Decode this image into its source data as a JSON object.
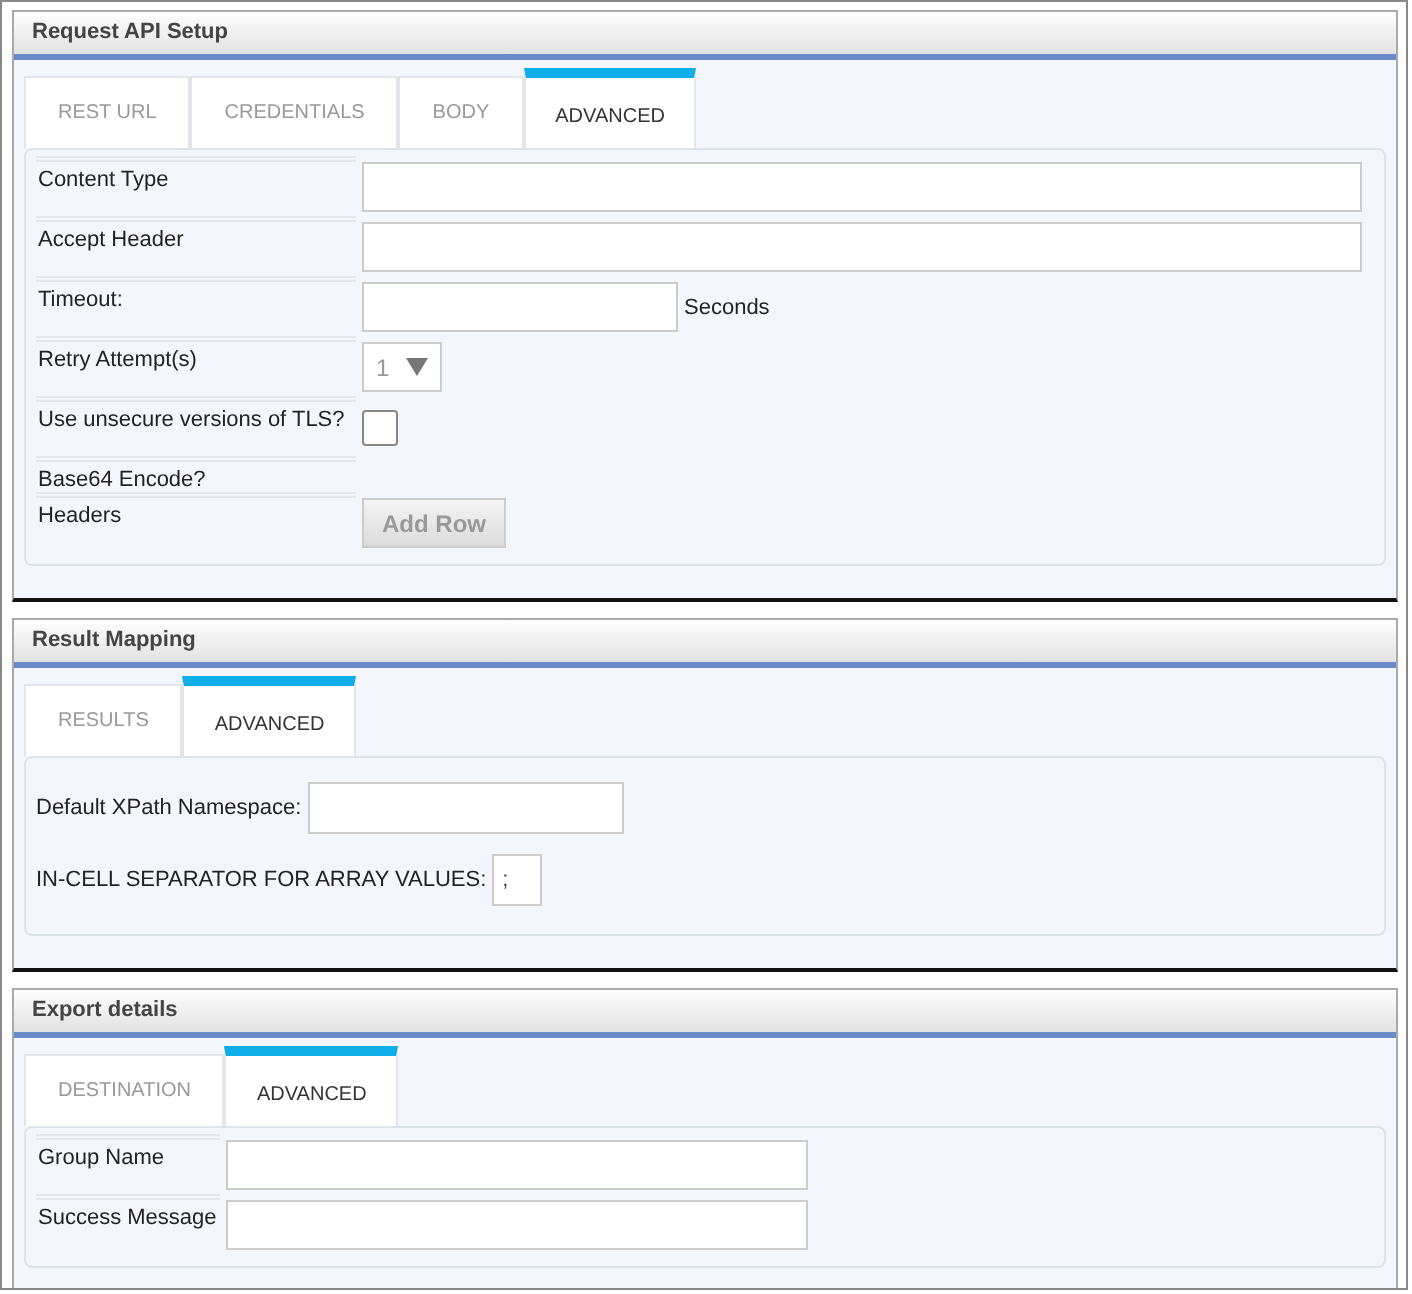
{
  "sections": [
    {
      "title": "Request API Setup",
      "kind": "table",
      "tabs": [
        {
          "label": "REST URL",
          "selected": false
        },
        {
          "label": "CREDENTIALS",
          "selected": false
        },
        {
          "label": "BODY",
          "selected": false
        },
        {
          "label": "ADVANCED",
          "selected": true
        }
      ],
      "rows": [
        {
          "label": "Content Type",
          "kind": "input"
        },
        {
          "label": "Accept Header",
          "kind": "input"
        },
        {
          "label": "Timeout:",
          "kind": "input",
          "suffix": "Seconds"
        },
        {
          "label": "Retry Attempt(s)",
          "kind": "select",
          "value": "1",
          "disabled": true
        },
        {
          "label": "Use unsecure versions of TLS?",
          "kind": "checkbox",
          "checked": false
        },
        {
          "label": "Base64 Encode?",
          "kind": "none"
        },
        {
          "label": "Headers",
          "kind": "button",
          "button": "Add Row",
          "disabled": true
        }
      ]
    },
    {
      "title": "Result Mapping",
      "kind": "inline",
      "tabs": [
        {
          "label": "RESULTS",
          "selected": false
        },
        {
          "label": "ADVANCED",
          "selected": true
        }
      ],
      "rows": [
        {
          "label": "Default XPath Namespace:",
          "kind": "input"
        },
        {
          "label": "IN-CELL SEPARATOR FOR ARRAY VALUES:",
          "kind": "input",
          "value": ";"
        }
      ]
    },
    {
      "title": "Export details",
      "kind": "table",
      "tabs": [
        {
          "label": "DESTINATION",
          "selected": false
        },
        {
          "label": "ADVANCED",
          "selected": true
        }
      ],
      "rows": [
        {
          "label": "Group Name",
          "kind": "input"
        },
        {
          "label": "Success Message",
          "kind": "input"
        }
      ]
    }
  ]
}
